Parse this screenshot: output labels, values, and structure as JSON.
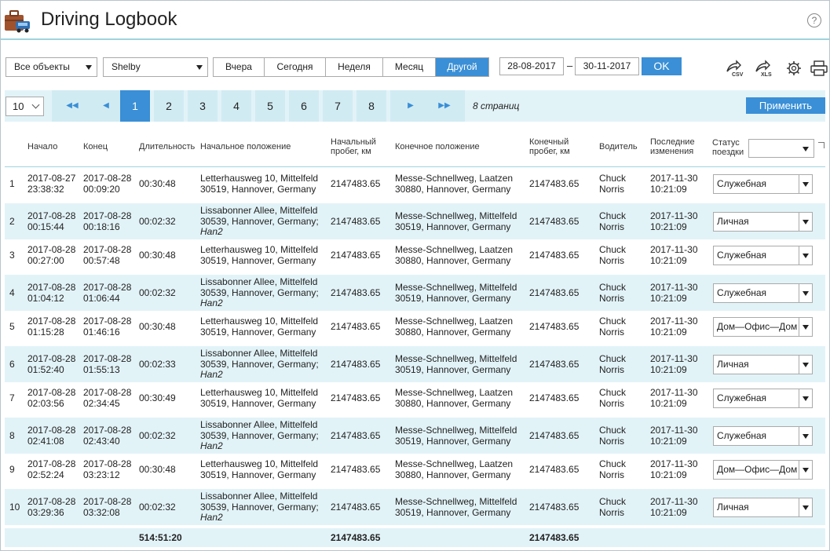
{
  "app": {
    "title": "Driving Logbook",
    "help_glyph": "?"
  },
  "toolbar": {
    "object_select": "Все объекты",
    "unit_select": "Shelby",
    "periods": [
      "Вчера",
      "Сегодня",
      "Неделя",
      "Месяц",
      "Другой"
    ],
    "active_period": "Другой",
    "date_from": "28-08-2017",
    "date_sep": "–",
    "date_to": "30-11-2017",
    "ok_label": "OK",
    "icons": [
      "export-csv-icon",
      "export-xls-icon",
      "gear-icon",
      "print-icon"
    ],
    "csv_label": "CSV",
    "xls_label": "XLS"
  },
  "pager": {
    "per_page": "10",
    "first_glyph": "◀◀",
    "prev_glyph": "◀",
    "next_glyph": "▶",
    "last_glyph": "▶▶",
    "pages": [
      "1",
      "2",
      "3",
      "4",
      "5",
      "6",
      "7",
      "8"
    ],
    "current_page": "1",
    "pages_info": "8 страниц",
    "apply_label": "Применить"
  },
  "table": {
    "headers": {
      "start": "Начало",
      "end": "Конец",
      "duration": "Длительность",
      "start_location": "Начальное положение",
      "start_mileage_1": "Начальный",
      "start_mileage_2": "пробег, км",
      "end_location": "Конечное положение",
      "end_mileage_1": "Конечный",
      "end_mileage_2": "пробег, км",
      "driver": "Водитель",
      "modified_1": "Последние",
      "modified_2": "изменения",
      "status_1": "Статус",
      "status_2": "поездки"
    },
    "rows": [
      {
        "n": "1",
        "start_d": "2017-08-27",
        "start_t": "23:38:32",
        "end_d": "2017-08-28",
        "end_t": "00:09:20",
        "dur": "00:30:48",
        "sl1": "Letterhausweg 10, Mittelfeld",
        "sl2": "30519, Hannover, Germany",
        "sl3": "",
        "sm": "2147483.65",
        "el1": "Messe-Schnellweg, Laatzen",
        "el2": "30880, Hannover, Germany",
        "em": "2147483.65",
        "drv1": "Chuck",
        "drv2": "Norris",
        "mod_d": "2017-11-30",
        "mod_t": "10:21:09",
        "status": "Служебная"
      },
      {
        "n": "2",
        "start_d": "2017-08-28",
        "start_t": "00:15:44",
        "end_d": "2017-08-28",
        "end_t": "00:18:16",
        "dur": "00:02:32",
        "sl1": "Lissabonner Allee, Mittelfeld",
        "sl2": "30539, Hannover, Germany;",
        "sl3": "Han2",
        "sm": "2147483.65",
        "el1": "Messe-Schnellweg, Mittelfeld",
        "el2": "30519, Hannover, Germany",
        "em": "2147483.65",
        "drv1": "Chuck",
        "drv2": "Norris",
        "mod_d": "2017-11-30",
        "mod_t": "10:21:09",
        "status": "Личная"
      },
      {
        "n": "3",
        "start_d": "2017-08-28",
        "start_t": "00:27:00",
        "end_d": "2017-08-28",
        "end_t": "00:57:48",
        "dur": "00:30:48",
        "sl1": "Letterhausweg 10, Mittelfeld",
        "sl2": "30519, Hannover, Germany",
        "sl3": "",
        "sm": "2147483.65",
        "el1": "Messe-Schnellweg, Laatzen",
        "el2": "30880, Hannover, Germany",
        "em": "2147483.65",
        "drv1": "Chuck",
        "drv2": "Norris",
        "mod_d": "2017-11-30",
        "mod_t": "10:21:09",
        "status": "Служебная"
      },
      {
        "n": "4",
        "start_d": "2017-08-28",
        "start_t": "01:04:12",
        "end_d": "2017-08-28",
        "end_t": "01:06:44",
        "dur": "00:02:32",
        "sl1": "Lissabonner Allee, Mittelfeld",
        "sl2": "30539, Hannover, Germany;",
        "sl3": "Han2",
        "sm": "2147483.65",
        "el1": "Messe-Schnellweg, Mittelfeld",
        "el2": "30519, Hannover, Germany",
        "em": "2147483.65",
        "drv1": "Chuck",
        "drv2": "Norris",
        "mod_d": "2017-11-30",
        "mod_t": "10:21:09",
        "status": "Служебная"
      },
      {
        "n": "5",
        "start_d": "2017-08-28",
        "start_t": "01:15:28",
        "end_d": "2017-08-28",
        "end_t": "01:46:16",
        "dur": "00:30:48",
        "sl1": "Letterhausweg 10, Mittelfeld",
        "sl2": "30519, Hannover, Germany",
        "sl3": "",
        "sm": "2147483.65",
        "el1": "Messe-Schnellweg, Laatzen",
        "el2": "30880, Hannover, Germany",
        "em": "2147483.65",
        "drv1": "Chuck",
        "drv2": "Norris",
        "mod_d": "2017-11-30",
        "mod_t": "10:21:09",
        "status": "Дом—Офис—Дом"
      },
      {
        "n": "6",
        "start_d": "2017-08-28",
        "start_t": "01:52:40",
        "end_d": "2017-08-28",
        "end_t": "01:55:13",
        "dur": "00:02:33",
        "sl1": "Lissabonner Allee, Mittelfeld",
        "sl2": "30539, Hannover, Germany;",
        "sl3": "Han2",
        "sm": "2147483.65",
        "el1": "Messe-Schnellweg, Mittelfeld",
        "el2": "30519, Hannover, Germany",
        "em": "2147483.65",
        "drv1": "Chuck",
        "drv2": "Norris",
        "mod_d": "2017-11-30",
        "mod_t": "10:21:09",
        "status": "Личная"
      },
      {
        "n": "7",
        "start_d": "2017-08-28",
        "start_t": "02:03:56",
        "end_d": "2017-08-28",
        "end_t": "02:34:45",
        "dur": "00:30:49",
        "sl1": "Letterhausweg 10, Mittelfeld",
        "sl2": "30519, Hannover, Germany",
        "sl3": "",
        "sm": "2147483.65",
        "el1": "Messe-Schnellweg, Laatzen",
        "el2": "30880, Hannover, Germany",
        "em": "2147483.65",
        "drv1": "Chuck",
        "drv2": "Norris",
        "mod_d": "2017-11-30",
        "mod_t": "10:21:09",
        "status": "Служебная"
      },
      {
        "n": "8",
        "start_d": "2017-08-28",
        "start_t": "02:41:08",
        "end_d": "2017-08-28",
        "end_t": "02:43:40",
        "dur": "00:02:32",
        "sl1": "Lissabonner Allee, Mittelfeld",
        "sl2": "30539, Hannover, Germany;",
        "sl3": "Han2",
        "sm": "2147483.65",
        "el1": "Messe-Schnellweg, Mittelfeld",
        "el2": "30519, Hannover, Germany",
        "em": "2147483.65",
        "drv1": "Chuck",
        "drv2": "Norris",
        "mod_d": "2017-11-30",
        "mod_t": "10:21:09",
        "status": "Служебная"
      },
      {
        "n": "9",
        "start_d": "2017-08-28",
        "start_t": "02:52:24",
        "end_d": "2017-08-28",
        "end_t": "03:23:12",
        "dur": "00:30:48",
        "sl1": "Letterhausweg 10, Mittelfeld",
        "sl2": "30519, Hannover, Germany",
        "sl3": "",
        "sm": "2147483.65",
        "el1": "Messe-Schnellweg, Laatzen",
        "el2": "30880, Hannover, Germany",
        "em": "2147483.65",
        "drv1": "Chuck",
        "drv2": "Norris",
        "mod_d": "2017-11-30",
        "mod_t": "10:21:09",
        "status": "Дом—Офис—Дом"
      },
      {
        "n": "10",
        "start_d": "2017-08-28",
        "start_t": "03:29:36",
        "end_d": "2017-08-28",
        "end_t": "03:32:08",
        "dur": "00:02:32",
        "sl1": "Lissabonner Allee, Mittelfeld",
        "sl2": "30539, Hannover, Germany;",
        "sl3": "Han2",
        "sm": "2147483.65",
        "el1": "Messe-Schnellweg, Mittelfeld",
        "el2": "30519, Hannover, Germany",
        "em": "2147483.65",
        "drv1": "Chuck",
        "drv2": "Norris",
        "mod_d": "2017-11-30",
        "mod_t": "10:21:09",
        "status": "Личная"
      }
    ],
    "totals": {
      "duration": "514:51:20",
      "start_mileage": "2147483.65",
      "end_mileage": "2147483.65"
    }
  },
  "colors": {
    "accent": "#3a8fd6",
    "row_alt": "#e2f3f8",
    "header_line": "#9fd3dd"
  }
}
